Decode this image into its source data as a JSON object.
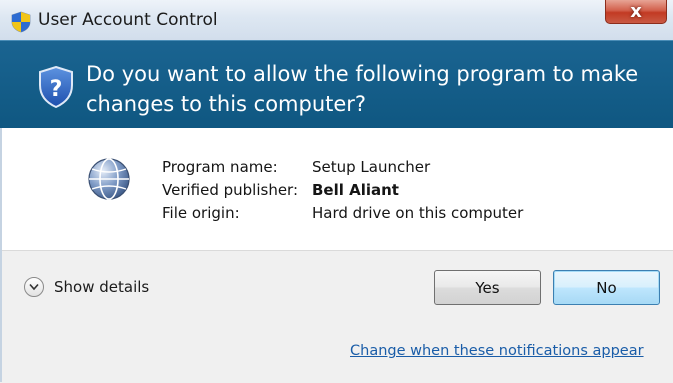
{
  "window": {
    "title": "User Account Control",
    "title_icon": "uac-shield-icon",
    "close_label": "x"
  },
  "banner": {
    "icon": "uac-shield-question-icon",
    "question": "Do you want to allow the following program to make changes to this computer?"
  },
  "program_info": {
    "icon": "globe-icon",
    "rows": [
      {
        "label": "Program name:",
        "value": "Setup Launcher"
      },
      {
        "label": "Verified publisher:",
        "value": "Bell Aliant"
      },
      {
        "label": "File origin:",
        "value": "Hard drive on this computer"
      }
    ]
  },
  "footer": {
    "details_icon": "chevron-down-icon",
    "details_label": "Show details",
    "yes_label": "Yes",
    "no_label": "No",
    "link_text": "Change when these notifications appear"
  },
  "colors": {
    "banner": "#0f5781",
    "link": "#1a5da8",
    "close": "#c23a23"
  }
}
